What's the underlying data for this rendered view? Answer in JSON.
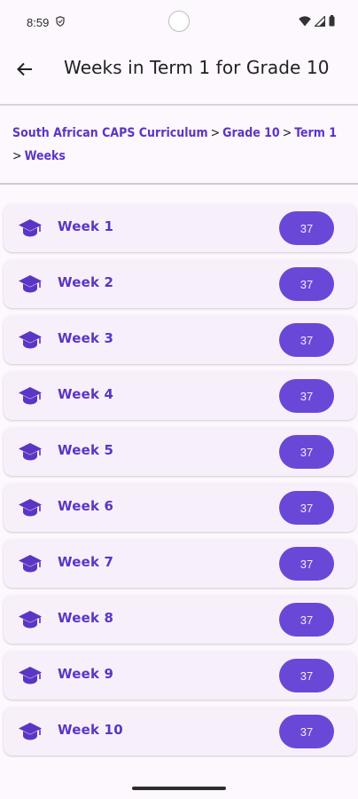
{
  "status_bar": {
    "time": "8:59"
  },
  "app_bar": {
    "title": "Weeks in Term 1 for Grade 10"
  },
  "breadcrumb": {
    "items": [
      "South African CAPS Curriculum",
      "Grade 10",
      "Term 1",
      "Weeks"
    ],
    "separator": ">"
  },
  "weeks": [
    {
      "label": "Week 1",
      "count": "37"
    },
    {
      "label": "Week 2",
      "count": "37"
    },
    {
      "label": "Week 3",
      "count": "37"
    },
    {
      "label": "Week 4",
      "count": "37"
    },
    {
      "label": "Week 5",
      "count": "37"
    },
    {
      "label": "Week 6",
      "count": "37"
    },
    {
      "label": "Week 7",
      "count": "37"
    },
    {
      "label": "Week 8",
      "count": "37"
    },
    {
      "label": "Week 9",
      "count": "37"
    },
    {
      "label": "Week 10",
      "count": "37"
    }
  ],
  "colors": {
    "accent": "#5b35c4",
    "badge_bg": "#6a48d7",
    "card_bg": "#f7f0fb",
    "page_bg": "#fdf7fe"
  },
  "icons": {
    "row": "graduation-cap-icon",
    "back": "arrow-back-icon"
  }
}
